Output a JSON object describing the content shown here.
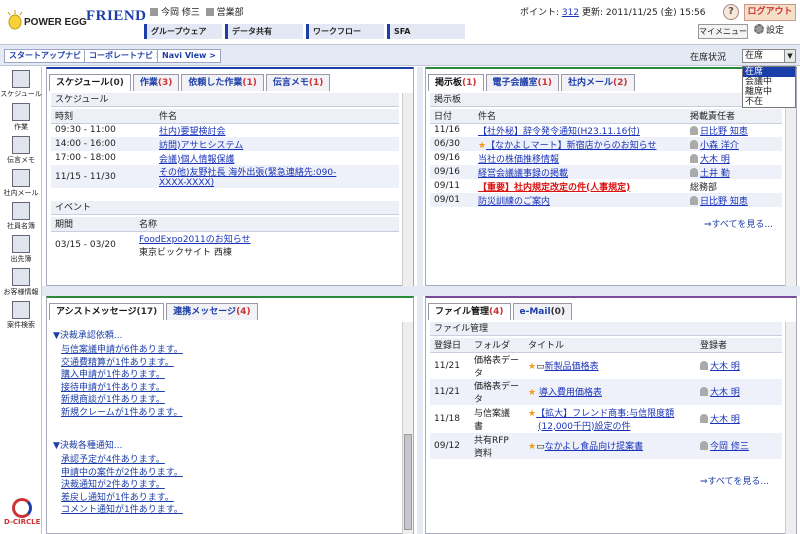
{
  "header": {
    "logo_text": "POWER EGG",
    "logo_friend": "FRIEND",
    "user_name": "今岡 修三",
    "department": "営業部",
    "points_label": "ポイント:",
    "points_value": "312",
    "updated_label": "更新: 2011/11/25 (金) 15:56",
    "help_label": "?",
    "logout_label": "ログアウト",
    "nav": [
      "グループウェア",
      "データ共有",
      "ワークフロー",
      "SFA"
    ],
    "mymenu_label": "マイメニュー",
    "settings_label": "設定"
  },
  "navrow": {
    "buttons": [
      "スタートアップナビ >",
      "コーポレートナビ >",
      "Navi View >"
    ],
    "status_label": "在席状況",
    "status_value": "在席",
    "status_options": [
      "在席",
      "会議中",
      "離席中",
      "不在"
    ]
  },
  "sidebar": {
    "items": [
      "スケジュール",
      "作業",
      "伝言メモ",
      "社内メール",
      "社員名簿",
      "出先簿",
      "お客様情報",
      "案件検索"
    ],
    "footer_logo": "D-CIRCLE"
  },
  "schedule_panel": {
    "tabs": [
      {
        "label": "スケジュール",
        "count": "(0)"
      },
      {
        "label": "作業",
        "count": "(3)"
      },
      {
        "label": "依頼した作業",
        "count": "(1)"
      },
      {
        "label": "伝言メモ",
        "count": "(1)"
      }
    ],
    "section_title": "スケジュール",
    "columns": [
      "時刻",
      "件名"
    ],
    "rows": [
      {
        "time": "09:30 - 11:00",
        "title": "社内)要望検討会"
      },
      {
        "time": "14:00 - 16:00",
        "title": "訪問)アサヒシステム"
      },
      {
        "time": "17:00 - 18:00",
        "title": "会議)個人情報保護"
      },
      {
        "time": "11/15 - 11/30",
        "title": "その他)友野社長 海外出張(緊急連絡先:090-",
        "title2": "XXXX-XXXX)"
      }
    ],
    "event_title": "イベント",
    "event_columns": [
      "期間",
      "名称"
    ],
    "events": [
      {
        "period": "03/15 - 03/20",
        "name": "FoodExpo2011のお知らせ",
        "place": "東京ビックサイト 西棟"
      }
    ]
  },
  "board_panel": {
    "tabs": [
      {
        "label": "掲示板",
        "count": "(1)"
      },
      {
        "label": "電子会議室",
        "count": "(1)"
      },
      {
        "label": "社内メール",
        "count": "(2)"
      }
    ],
    "section_title": "掲示板",
    "columns": [
      "日付",
      "件名",
      "掲載責任者"
    ],
    "rows": [
      {
        "date": "11/16",
        "star": "",
        "title": "【社外秘】辞令発令通知(H23.11.16付)",
        "owner": "日比野 知恵",
        "important": false
      },
      {
        "date": "06/30",
        "star": "★",
        "title": "【なかよしマート】新宿店からのお知らせ",
        "owner": "小森 洋介",
        "important": false
      },
      {
        "date": "09/16",
        "star": "",
        "title": "当社の株価推移情報",
        "owner": "大木 明",
        "important": false
      },
      {
        "date": "09/16",
        "star": "",
        "title": "経営会議議事録の掲載",
        "owner": "土井 勤",
        "important": false
      },
      {
        "date": "09/11",
        "star": "",
        "title": "【重要】社内規定改定の件(人事規定)",
        "owner": "総務部",
        "important": true
      },
      {
        "date": "09/01",
        "star": "",
        "title": "防災訓練のご案内",
        "owner": "日比野 知恵",
        "important": false
      }
    ],
    "more_label": "⇒すべてを見る..."
  },
  "assist_panel": {
    "tabs": [
      {
        "label": "アシストメッセージ",
        "count": "(17)"
      },
      {
        "label": "連携メッセージ",
        "count": "(4)"
      }
    ],
    "groups": [
      {
        "title": "▼決裁承認依頼...",
        "items": [
          "与信案議申請が6件あります。",
          "交通費精算が1件あります。",
          "購入申請が1件あります。",
          "接待申請が1件あります。",
          "新規商談が1件あります。",
          "新規クレームが1件あります。"
        ]
      },
      {
        "title": "▼決裁各種通知...",
        "items": [
          "承認予定が4件あります。",
          "申請中の案件が2件あります。",
          "決裁通知が2件あります。",
          "差戻し通知が1件あります。",
          "コメント通知が1件あります。"
        ]
      }
    ]
  },
  "file_panel": {
    "tabs": [
      {
        "label": "ファイル管理",
        "count": "(4)"
      },
      {
        "label": "e-Mail",
        "count": "(0)"
      }
    ],
    "section_title": "ファイル管理",
    "columns": [
      "登録日",
      "フォルダ",
      "タイトル",
      "登録者"
    ],
    "rows": [
      {
        "date": "11/21",
        "folder": "価格表デー",
        "folder2": "タ",
        "title": "新製品価格表",
        "owner": "大木 明"
      },
      {
        "date": "11/21",
        "folder": "価格表デー",
        "folder2": "タ",
        "title": "導入費用価格表",
        "owner": "大木 明"
      },
      {
        "date": "11/18",
        "folder": "与信案議",
        "folder2": "書",
        "title": "【拡大】フレンド商事:与信限度額",
        "title2": "(12,000千円)設定の件",
        "owner": "大木 明"
      },
      {
        "date": "09/12",
        "folder": "共有RFP",
        "folder2": "資料",
        "title": "なかよし食品向け提案書",
        "owner": "今岡 修三"
      }
    ],
    "more_label": "⇒すべてを見る..."
  }
}
